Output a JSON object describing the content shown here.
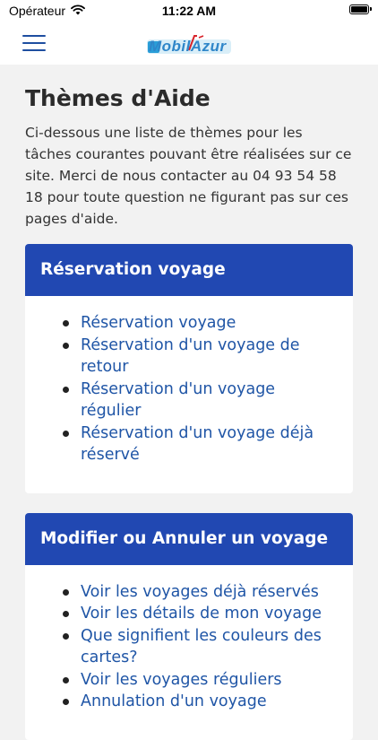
{
  "status_bar": {
    "carrier": "Opérateur",
    "time": "11:22 AM",
    "wifi_icon": "wifi-icon",
    "battery_icon": "battery-icon"
  },
  "header": {
    "menu_icon": "hamburger-menu-icon",
    "logo_text": "MobilAzur"
  },
  "page": {
    "title": "Thèmes d'Aide",
    "intro": "Ci-dessous une liste de thèmes pour les tâches courantes pouvant être réalisées sur ce site. Merci de nous contacter au 04 93 54 58 18 pour toute question ne figurant pas sur ces pages d'aide."
  },
  "sections": [
    {
      "title": "Réservation voyage",
      "items": [
        "Réservation voyage",
        "Réservation d'un voyage de retour",
        "Réservation d'un voyage régulier",
        "Réservation d'un voyage déjà réservé"
      ]
    },
    {
      "title": "Modifier ou Annuler un voyage",
      "items": [
        "Voir les voyages déjà réservés",
        "Voir les détails de mon voyage",
        "Que signifient les couleurs des cartes?",
        "Voir les voyages réguliers",
        "Annulation d'un voyage"
      ]
    }
  ],
  "colors": {
    "accent": "#2148b2",
    "link": "#1f55a6",
    "background": "#f2f2f2"
  }
}
